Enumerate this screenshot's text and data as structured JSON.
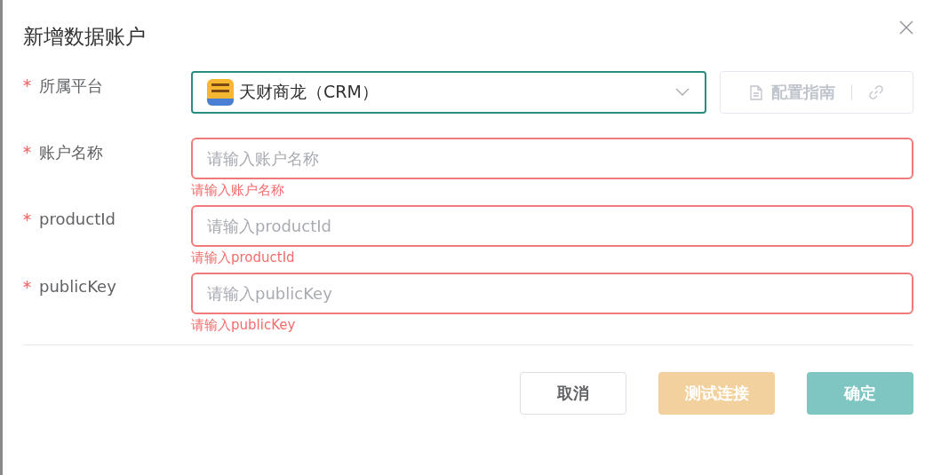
{
  "dialog": {
    "title": "新增数据账户"
  },
  "fields": [
    {
      "kind": "select",
      "label": "所属平台",
      "required": true,
      "value": "天财商龙（CRM）",
      "focused": true
    },
    {
      "kind": "input",
      "label": "账户名称",
      "required": true,
      "placeholder": "请输入账户名称",
      "error": "请输入账户名称"
    },
    {
      "kind": "input",
      "label": "productId",
      "required": true,
      "placeholder": "请输入productId",
      "error": "请输入productId"
    },
    {
      "kind": "input",
      "label": "publicKey",
      "required": true,
      "placeholder": "请输入publicKey",
      "error": "请输入publicKey"
    }
  ],
  "guide_button": {
    "label": "配置指南",
    "disabled": true
  },
  "buttons": [
    {
      "label": "取消",
      "kind": "default",
      "disabled": false
    },
    {
      "label": "测试连接",
      "kind": "warning",
      "disabled": true
    },
    {
      "label": "确定",
      "kind": "primary",
      "disabled": true
    }
  ]
}
